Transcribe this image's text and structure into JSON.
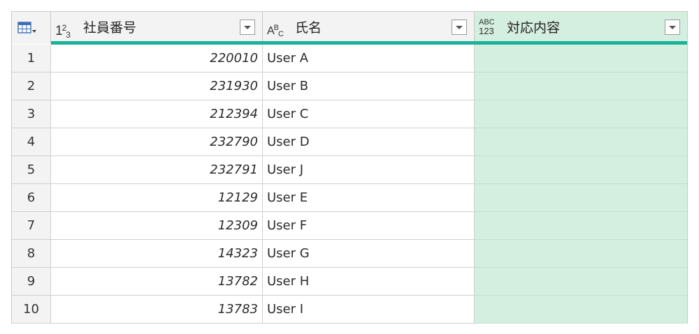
{
  "columns": [
    {
      "type_icon": "whole-number-icon",
      "type_label_base": "1",
      "type_label_sup": "2",
      "type_label_sub": "3",
      "title": "社員番号"
    },
    {
      "type_icon": "text-type-icon",
      "type_label_base": "A",
      "type_label_sup": "B",
      "type_label_sub": "C",
      "title": "氏名"
    },
    {
      "type_icon": "any-type-icon",
      "type_label_top": "ABC",
      "type_label_bottom": "123",
      "title": "対応内容"
    }
  ],
  "rows": [
    {
      "num": "1",
      "id": "220010",
      "name": "User A",
      "response": ""
    },
    {
      "num": "2",
      "id": "231930",
      "name": "User B",
      "response": ""
    },
    {
      "num": "3",
      "id": "212394",
      "name": "User C",
      "response": ""
    },
    {
      "num": "4",
      "id": "232790",
      "name": "User D",
      "response": ""
    },
    {
      "num": "5",
      "id": "232791",
      "name": "User J",
      "response": ""
    },
    {
      "num": "6",
      "id": "12129",
      "name": "User E",
      "response": ""
    },
    {
      "num": "7",
      "id": "12309",
      "name": "User F",
      "response": ""
    },
    {
      "num": "8",
      "id": "14323",
      "name": "User G",
      "response": ""
    },
    {
      "num": "9",
      "id": "13782",
      "name": "User H",
      "response": ""
    },
    {
      "num": "10",
      "id": "13783",
      "name": "User I",
      "response": ""
    }
  ],
  "colors": {
    "quality_bar": "#1ab29a",
    "highlight_column": "#d4eedf",
    "header_bg": "#f3f3f3"
  }
}
